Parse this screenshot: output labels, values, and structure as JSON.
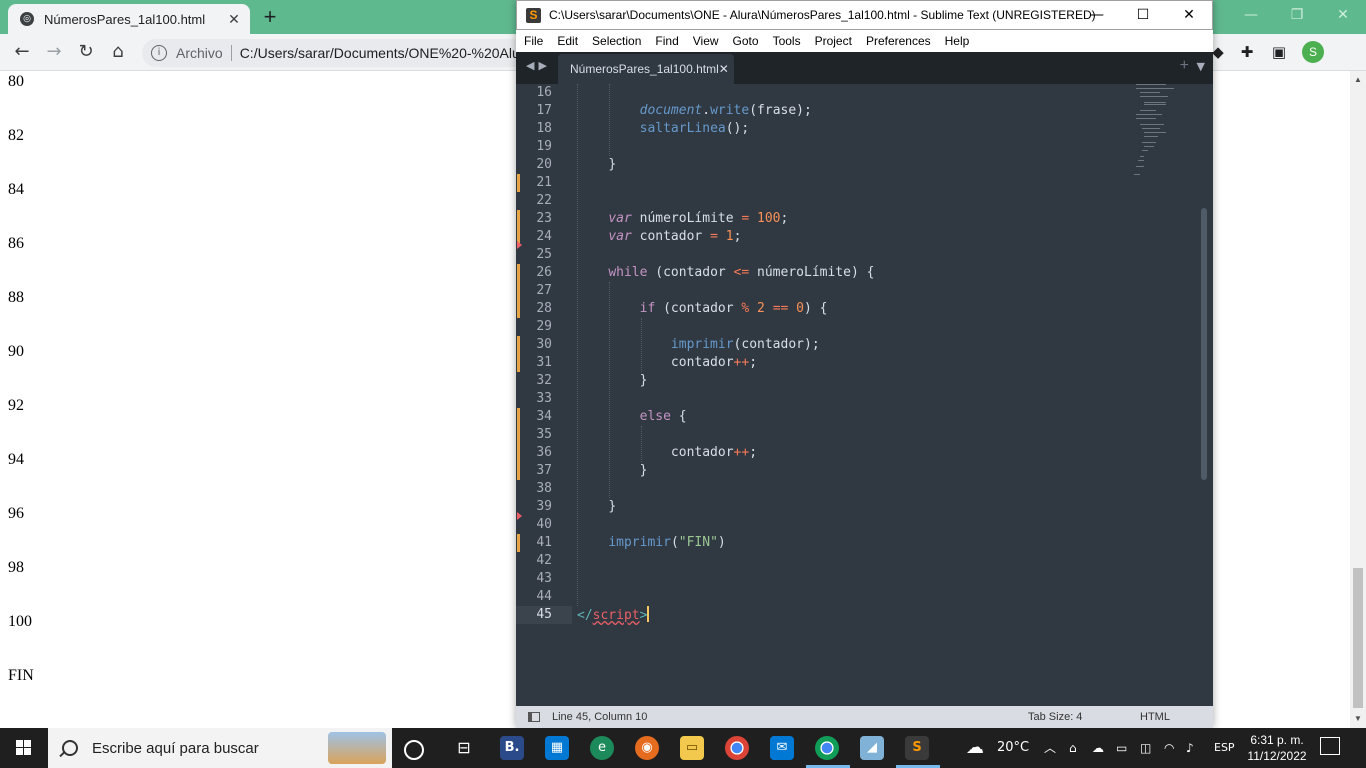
{
  "browser": {
    "tab_title": "NúmerosPares_1al100.html",
    "tab_close": "✕",
    "new_tab": "+",
    "nav": {
      "back": "←",
      "forward": "→",
      "reload": "↻",
      "home": "⌂"
    },
    "address": {
      "scheme_label": "Archivo",
      "url": "C:/Users/sarar/Documents/ONE%20-%20Alura/NúmerosPares_1al100.html"
    },
    "profile_initial": "S",
    "page_lines": [
      "80",
      "82",
      "84",
      "86",
      "88",
      "90",
      "92",
      "94",
      "96",
      "98",
      "100",
      "FIN"
    ]
  },
  "sublime": {
    "window_title": "C:\\Users\\sarar\\Documents\\ONE - Alura\\NúmerosPares_1al100.html - Sublime Text (UNREGISTERED)",
    "menu": [
      "File",
      "Edit",
      "Selection",
      "Find",
      "View",
      "Goto",
      "Tools",
      "Project",
      "Preferences",
      "Help"
    ],
    "tab_name": "NúmerosPares_1al100.html",
    "tab_close": "✕",
    "line_numbers": [
      "16",
      "17",
      "18",
      "19",
      "20",
      "21",
      "22",
      "23",
      "24",
      "25",
      "26",
      "27",
      "28",
      "29",
      "30",
      "31",
      "32",
      "33",
      "34",
      "35",
      "36",
      "37",
      "38",
      "39",
      "40",
      "41",
      "42",
      "43",
      "44",
      "45"
    ],
    "code": {
      "l17": {
        "obj": "document",
        "dot": ".",
        "method": "write",
        "args": "(frase);"
      },
      "l18": {
        "fn": "saltarLinea",
        "rest": "();"
      },
      "l20": "}",
      "l23": {
        "kw": "var",
        "name": " númeroLímite ",
        "op": "=",
        "val": "100",
        "end": ";"
      },
      "l24": {
        "kw": "var",
        "name": " contador ",
        "op": "=",
        "val": "1",
        "end": ";"
      },
      "l26": {
        "kw": "while",
        "a": " (contador ",
        "op": "<=",
        "b": " númeroLímite) {"
      },
      "l28": {
        "kw": "if",
        "a": " (contador ",
        "op1": "%",
        "n1": "2",
        "op2": "==",
        "n2": "0",
        "b": ") {"
      },
      "l30": {
        "fn": "imprimir",
        "rest": "(contador);"
      },
      "l31": {
        "name": "contador",
        "op": "++",
        "end": ";"
      },
      "l32": "}",
      "l34": {
        "kw": "else",
        "rest": " {"
      },
      "l36": {
        "name": "contador",
        "op": "++",
        "end": ";"
      },
      "l37": "}",
      "l39": "}",
      "l41": {
        "fn": "imprimir",
        "open": "(",
        "str": "\"FIN\"",
        "close": ")"
      },
      "l45": {
        "open": "</",
        "tag": "script",
        "close": ">"
      }
    },
    "status": {
      "position": "Line 45, Column 10",
      "tab_size": "Tab Size: 4",
      "syntax": "HTML"
    }
  },
  "taskbar": {
    "search_placeholder": "Escribe aquí para buscar",
    "weather": "20°C",
    "language": "ESP",
    "time": "6:31 p. m.",
    "date": "11/12/2022"
  },
  "colors": {
    "browser_frame": "#5fb98f",
    "editor_bg": "#303841",
    "modified_marker": "#e7a548",
    "caret": "#fac863"
  }
}
